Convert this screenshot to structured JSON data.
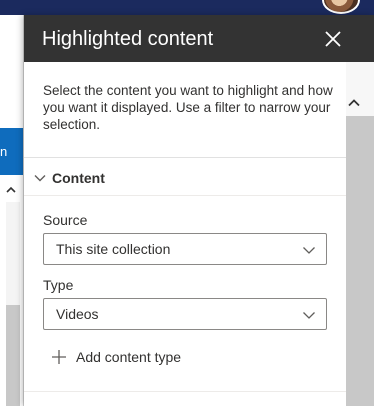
{
  "panel": {
    "title": "Highlighted content",
    "description": "Select the content you want to highlight and how you want it displayed. Use a filter to narrow your selection."
  },
  "content_section": {
    "title": "Content",
    "source": {
      "label": "Source",
      "value": "This site collection"
    },
    "type": {
      "label": "Type",
      "value": "Videos"
    },
    "add_label": "Add content type"
  },
  "background": {
    "tab_text": "n"
  },
  "icons": {
    "close": "close-icon",
    "section_chevron": "chevron-down-icon",
    "dropdown_chevron": "chevron-down-icon",
    "add": "plus-icon",
    "scroll_up": "chevron-up-icon"
  },
  "colors": {
    "header_bg": "#333333",
    "accent": "#0f6cbd",
    "topbar": "#1b2a5e"
  }
}
